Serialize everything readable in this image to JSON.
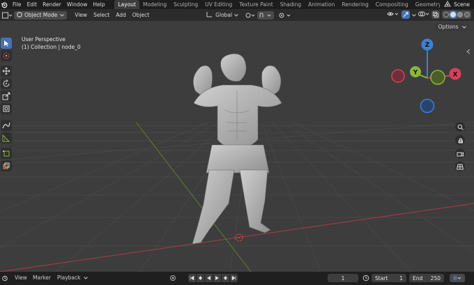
{
  "menu": {
    "items": [
      "File",
      "Edit",
      "Render",
      "Window",
      "Help"
    ]
  },
  "workspaces": {
    "tabs": [
      "Layout",
      "Modeling",
      "Sculpting",
      "UV Editing",
      "Texture Paint",
      "Shading",
      "Animation",
      "Rendering",
      "Compositing",
      "Geometry Nodes"
    ],
    "active": "Layout"
  },
  "scene": {
    "label": "Scene"
  },
  "header": {
    "mode": "Object Mode",
    "view": "View",
    "select": "Select",
    "add": "Add",
    "object": "Object",
    "orientation": "Global"
  },
  "viewport": {
    "perspective": "User Perspective",
    "collection": "(1) Collection | node_0",
    "options": "Options"
  },
  "gizmo": {
    "z": "Z",
    "y": "Y",
    "x": "X"
  },
  "timeline": {
    "view": "View",
    "marker": "Marker",
    "playback": "Playback",
    "current_frame": "1",
    "start_label": "Start",
    "start": "1",
    "end_label": "End",
    "end": "250"
  },
  "colors": {
    "accent": "#4772b3",
    "axis_x": "#d9405a",
    "axis_y": "#8bb63a",
    "axis_z": "#3d7fd6"
  }
}
